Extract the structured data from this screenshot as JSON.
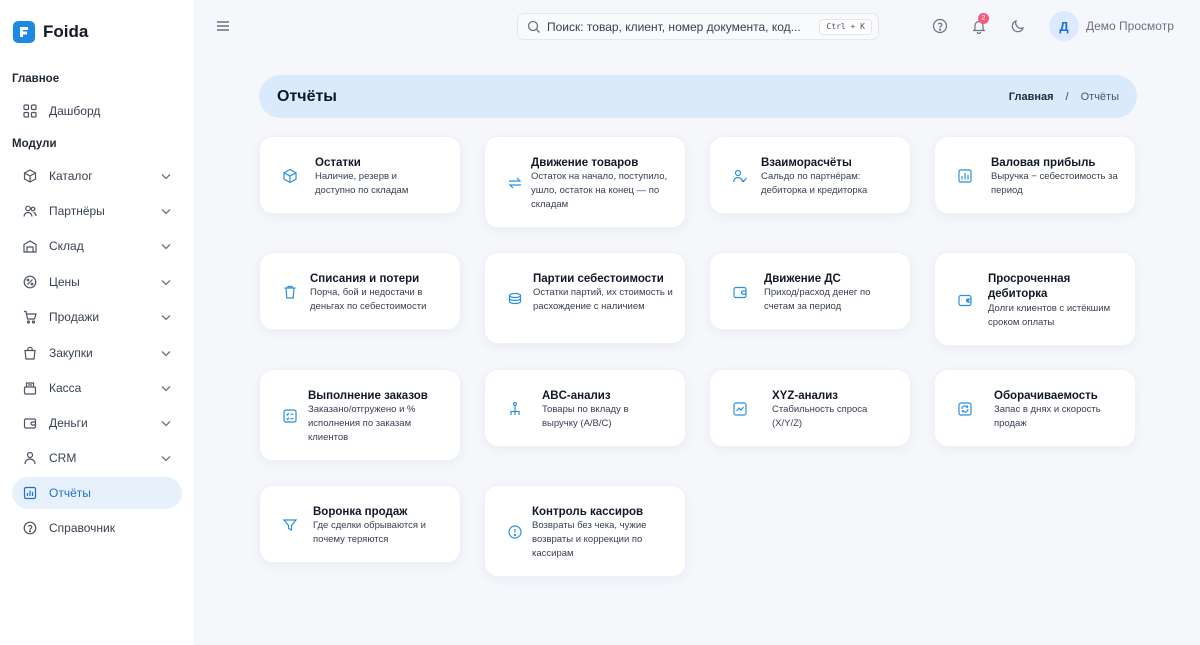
{
  "app": {
    "name": "Foida"
  },
  "sidebar": {
    "section_main": "Главное",
    "section_modules": "Модули",
    "dashboard": "Дашборд",
    "items": [
      {
        "label": "Каталог",
        "icon": "cube-icon"
      },
      {
        "label": "Партнёры",
        "icon": "users-icon"
      },
      {
        "label": "Склад",
        "icon": "warehouse-icon"
      },
      {
        "label": "Цены",
        "icon": "tag-icon"
      },
      {
        "label": "Продажи",
        "icon": "cart-icon"
      },
      {
        "label": "Закупки",
        "icon": "bag-icon"
      },
      {
        "label": "Касса",
        "icon": "register-icon"
      },
      {
        "label": "Деньги",
        "icon": "wallet-icon"
      },
      {
        "label": "CRM",
        "icon": "crm-icon"
      },
      {
        "label": "Отчёты",
        "icon": "chart-icon",
        "active": true
      },
      {
        "label": "Справочник",
        "icon": "help-icon"
      }
    ]
  },
  "topbar": {
    "search_placeholder": "Поиск: товар, клиент, номер документа, код...",
    "search_shortcut": "Ctrl + K",
    "notification_count": "2",
    "user_initial": "Д",
    "user_name": "Демо Просмотр"
  },
  "page": {
    "title": "Отчёты",
    "breadcrumb_home": "Главная",
    "breadcrumb_sep": "/",
    "breadcrumb_current": "Отчёты"
  },
  "reports": [
    {
      "title": "Остатки",
      "desc": "Наличие, резерв и доступно по складам",
      "icon": "cube-icon"
    },
    {
      "title": "Движение товаров",
      "desc": "Остаток на начало, поступило, ушло, остаток на конец — по складам",
      "icon": "arrows-icon"
    },
    {
      "title": "Взаиморасчёты",
      "desc": "Сальдо по партнёрам: дебиторка и кредиторка",
      "icon": "users-icon"
    },
    {
      "title": "Валовая прибыль",
      "desc": "Выручка − себестоимость за период",
      "icon": "chart-icon"
    },
    {
      "title": "Списания и потери",
      "desc": "Порча, бой и недостачи в деньгах по себестоимости",
      "icon": "trash-icon"
    },
    {
      "title": "Партии себестоимости",
      "desc": "Остатки партий, их стоимость и расхождение с наличием",
      "icon": "layers-icon"
    },
    {
      "title": "Движение ДС",
      "desc": "Приход/расход денег по счетам за период",
      "icon": "wallet-icon"
    },
    {
      "title": "Просроченная дебиторка",
      "desc": "Долги клиентов с истёкшим сроком оплаты",
      "icon": "wallet-alert-icon"
    },
    {
      "title": "Выполнение заказов",
      "desc": "Заказано/отгружено и % исполнения по заказам клиентов",
      "icon": "checklist-icon"
    },
    {
      "title": "ABC-анализ",
      "desc": "Товары по вкладу в выручку (A/B/C)",
      "icon": "hierarchy-icon"
    },
    {
      "title": "XYZ-анализ",
      "desc": "Стабильность спроса (X/Y/Z)",
      "icon": "trend-icon"
    },
    {
      "title": "Оборачиваемость",
      "desc": "Запас в днях и скорость продаж",
      "icon": "cycle-icon"
    },
    {
      "title": "Воронка продаж",
      "desc": "Где сделки обрываются и почему теряются",
      "icon": "funnel-icon"
    },
    {
      "title": "Контроль кассиров",
      "desc": "Возвраты без чека, чужие возвраты и коррекции по кассирам",
      "icon": "shield-icon"
    }
  ]
}
